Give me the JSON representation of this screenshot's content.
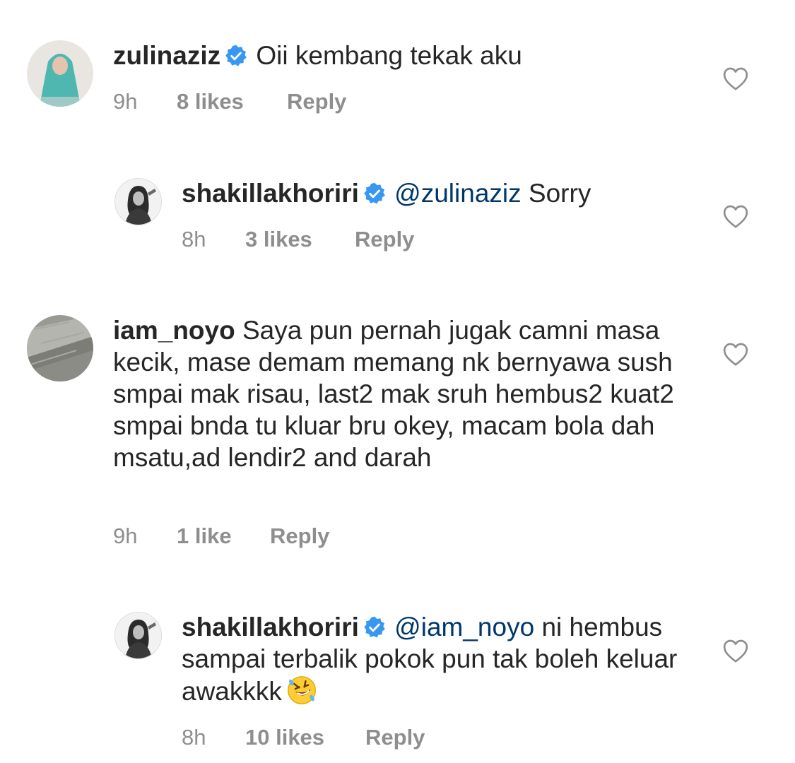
{
  "comments": [
    {
      "username": "zulinaziz",
      "verified": true,
      "mention": "",
      "text": "Oii kembang tekak aku",
      "time": "9h",
      "likes": "8 likes",
      "reply": "Reply"
    },
    {
      "username": "shakillakhoriri",
      "verified": true,
      "mention": "@zulinaziz",
      "text": "Sorry",
      "time": "8h",
      "likes": "3 likes",
      "reply": "Reply"
    },
    {
      "username": "iam_noyo",
      "verified": false,
      "mention": "",
      "text": "Saya pun pernah jugak camni masa kecik, mase demam memang nk bernyawa sush smpai mak risau, last2 mak sruh hembus2 kuat2 smpai bnda tu kluar bru okey, macam bola dah msatu,ad lendir2 and darah",
      "time": "9h",
      "likes": "1 like",
      "reply": "Reply"
    },
    {
      "username": "shakillakhoriri",
      "verified": true,
      "mention": "@iam_noyo",
      "text": "ni hembus sampai terbalik pokok pun tak boleh keluar awakkkk",
      "emoji": "rolling-on-floor-laughing",
      "time": "8h",
      "likes": "10 likes",
      "reply": "Reply"
    }
  ],
  "colors": {
    "text": "#262626",
    "meta": "#8e8e8e",
    "mention": "#00376b",
    "verified": "#3897f0"
  },
  "icons": {
    "verified": "verified-badge-icon",
    "like": "heart-outline-icon"
  }
}
